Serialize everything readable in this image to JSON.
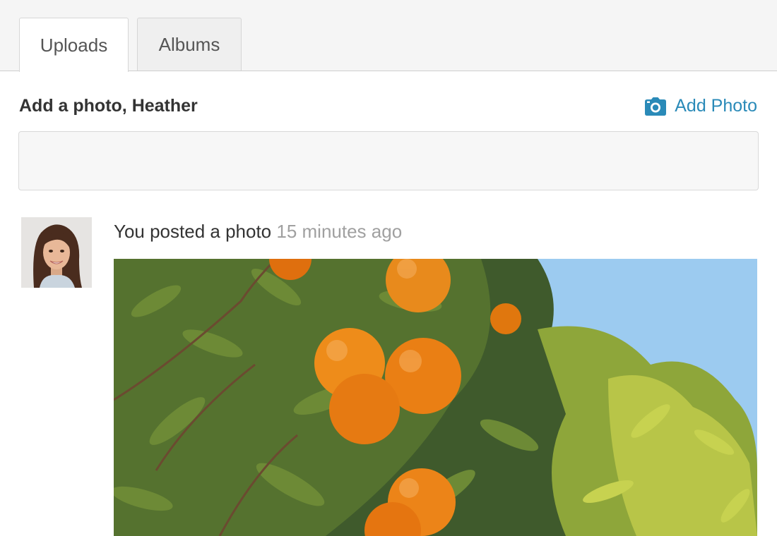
{
  "tabs": [
    {
      "label": "Uploads",
      "active": true
    },
    {
      "label": "Albums",
      "active": false
    }
  ],
  "composer": {
    "title": "Add a photo, Heather",
    "add_photo_label": "Add Photo",
    "add_photo_icon": "camera-icon",
    "input_value": "",
    "accent_color": "#2a8ab8"
  },
  "post": {
    "action_text": "You posted a photo",
    "time_text": "15 minutes ago"
  }
}
